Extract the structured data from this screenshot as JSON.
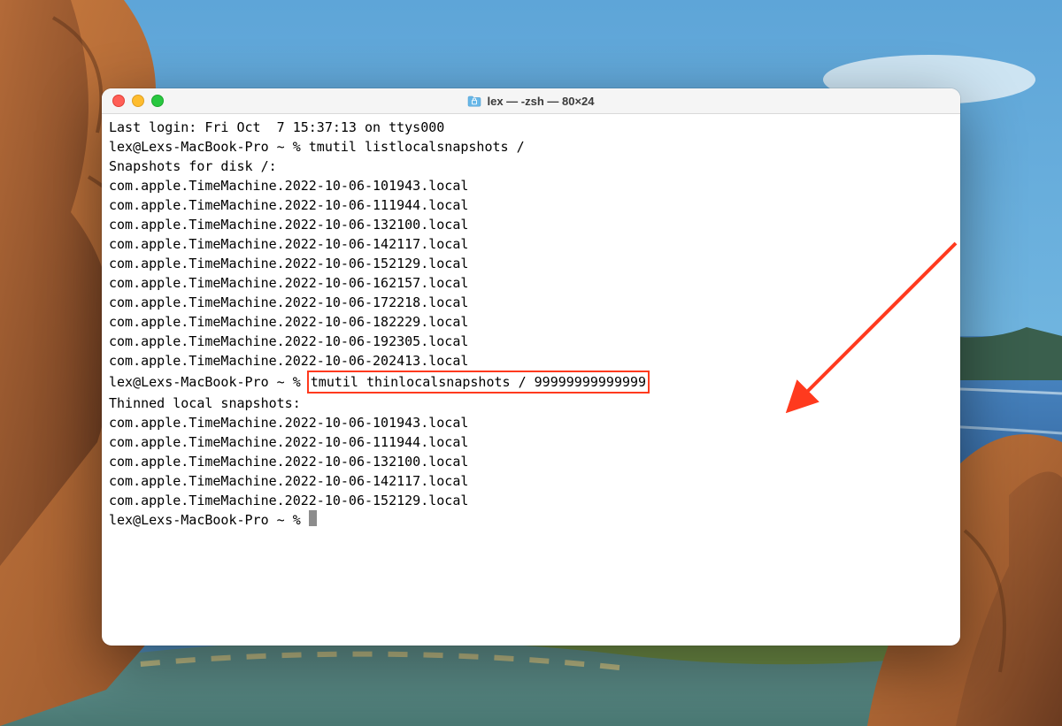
{
  "window": {
    "title": "lex — -zsh — 80×24"
  },
  "terminal": {
    "last_login": "Last login: Fri Oct  7 15:37:13 on ttys000",
    "prompt_host": "lex@Lexs-MacBook-Pro ~ % ",
    "cmd1": "tmutil listlocalsnapshots /",
    "snapshots_header": "Snapshots for disk /:",
    "snapshots_list": [
      "com.apple.TimeMachine.2022-10-06-101943.local",
      "com.apple.TimeMachine.2022-10-06-111944.local",
      "com.apple.TimeMachine.2022-10-06-132100.local",
      "com.apple.TimeMachine.2022-10-06-142117.local",
      "com.apple.TimeMachine.2022-10-06-152129.local",
      "com.apple.TimeMachine.2022-10-06-162157.local",
      "com.apple.TimeMachine.2022-10-06-172218.local",
      "com.apple.TimeMachine.2022-10-06-182229.local",
      "com.apple.TimeMachine.2022-10-06-192305.local",
      "com.apple.TimeMachine.2022-10-06-202413.local"
    ],
    "cmd2": "tmutil thinlocalsnapshots / 99999999999999",
    "thinned_header": "Thinned local snapshots:",
    "thinned_list": [
      "com.apple.TimeMachine.2022-10-06-101943.local",
      "com.apple.TimeMachine.2022-10-06-111944.local",
      "com.apple.TimeMachine.2022-10-06-132100.local",
      "com.apple.TimeMachine.2022-10-06-142117.local",
      "com.apple.TimeMachine.2022-10-06-152129.local"
    ]
  },
  "annotation": {
    "color": "#ff3a1e"
  }
}
